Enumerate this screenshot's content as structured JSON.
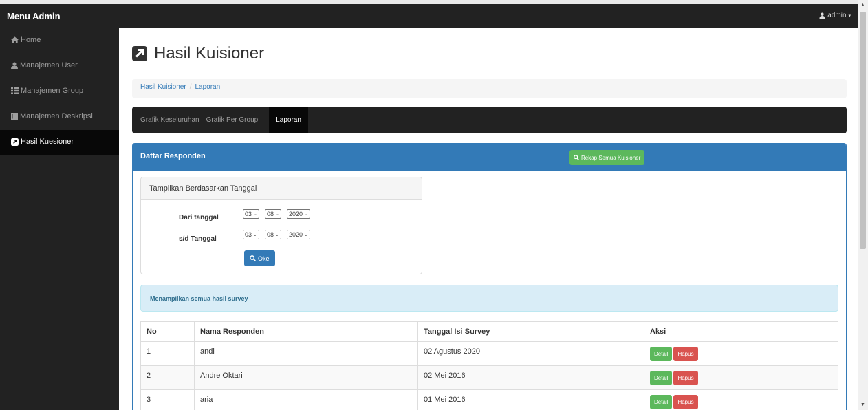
{
  "app": {
    "brand": "Menu Admin",
    "user": "admin"
  },
  "sidebar": {
    "items": [
      {
        "label": "Home",
        "icon": "home-icon"
      },
      {
        "label": "Manajemen User",
        "icon": "user-icon"
      },
      {
        "label": "Manajemen Group",
        "icon": "list-icon"
      },
      {
        "label": "Manajemen Deskripsi",
        "icon": "book-icon"
      },
      {
        "label": "Hasil Kuesioner",
        "icon": "external-link-icon",
        "active": true
      }
    ]
  },
  "page": {
    "title": "Hasil Kuisioner",
    "title_icon": "external-link-icon"
  },
  "breadcrumb": {
    "items": [
      "Hasil Kuisioner",
      "Laporan"
    ]
  },
  "tabs": [
    {
      "label": "Grafik Keseluruhan"
    },
    {
      "label": "Grafik Per Group"
    },
    {
      "label": "Laporan",
      "active": true
    }
  ],
  "panel": {
    "title": "Daftar Responden",
    "rekap_button": "Rekap Semua Kuisioner"
  },
  "filter": {
    "heading": "Tampilkan Berdasarkan Tanggal",
    "from_label": "Dari tanggal",
    "to_label": "s/d Tanggal",
    "from": {
      "day": "03",
      "month": "08",
      "year": "2020"
    },
    "to": {
      "day": "03",
      "month": "08",
      "year": "2020"
    },
    "submit_label": "Oke"
  },
  "alert": {
    "text": "Menampilkan semua hasil survey"
  },
  "table": {
    "headers": [
      "No",
      "Nama Responden",
      "Tanggal Isi Survey",
      "Aksi"
    ],
    "rows": [
      {
        "no": "1",
        "nama": "andi",
        "tanggal": "02 Agustus 2020"
      },
      {
        "no": "2",
        "nama": "Andre Oktari",
        "tanggal": "02 Mei 2016"
      },
      {
        "no": "3",
        "nama": "aria",
        "tanggal": "01 Mei 2016"
      }
    ],
    "detail_label": "Detail",
    "hapus_label": "Hapus"
  },
  "colors": {
    "navbar": "#222222",
    "primary": "#337ab7",
    "success": "#5cb85c",
    "danger": "#d9534f",
    "info_bg": "#d9edf7"
  }
}
